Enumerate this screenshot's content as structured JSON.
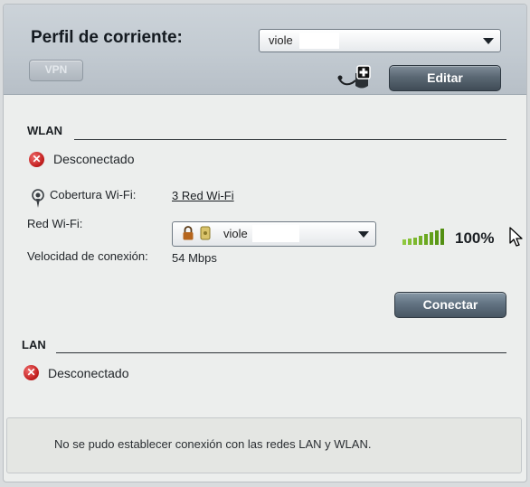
{
  "header": {
    "profile_label": "Perfil de corriente:",
    "profile_value": "viole",
    "vpn_label": "VPN",
    "edit_label": "Editar"
  },
  "wlan": {
    "title": "WLAN",
    "status": "Desconectado",
    "coverage_label": "Cobertura Wi-Fi:",
    "coverage_link": "3 Red Wi-Fi",
    "network_label": "Red Wi-Fi:",
    "network_value": "viole",
    "signal_percent": "100%",
    "speed_label": "Velocidad de conexión:",
    "speed_value": "54 Mbps",
    "connect_label": "Conectar"
  },
  "lan": {
    "title": "LAN",
    "status": "Desconectado"
  },
  "message": "No se pudo establecer conexión con las redes LAN y WLAN.",
  "icons": {
    "error": "x-circle-icon",
    "antenna": "antenna-icon",
    "lock": "lock-icon",
    "plug": "plug-add-icon",
    "signal": "signal-bars-icon",
    "cursor": "mouse-cursor-icon"
  },
  "colors": {
    "error_red": "#c21f1f",
    "signal_green": "#6aa820",
    "button_dark": "#4f5c68"
  }
}
